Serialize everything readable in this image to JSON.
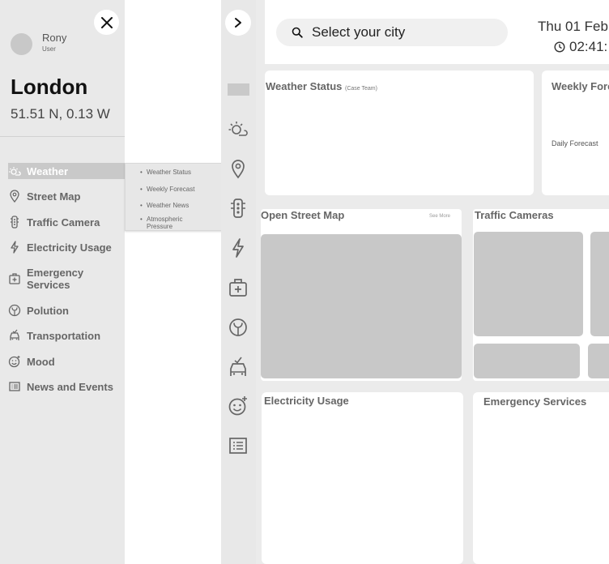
{
  "drawer": {
    "user": {
      "name": "Rony",
      "role": "User"
    },
    "city": "London",
    "coordinates": "51.51 N, 0.13 W",
    "nav": [
      {
        "label": "Weather",
        "icon": "weather-icon",
        "active": true
      },
      {
        "label": "Street Map",
        "icon": "location-pin-icon"
      },
      {
        "label": "Traffic Camera",
        "icon": "traffic-light-icon"
      },
      {
        "label": "Electricity Usage",
        "icon": "lightning-icon"
      },
      {
        "label": "Emergency Services",
        "icon": "first-aid-icon"
      },
      {
        "label": "Polution",
        "icon": "leaf-icon"
      },
      {
        "label": "Transportation",
        "icon": "bus-icon"
      },
      {
        "label": "Mood",
        "icon": "smiley-icon"
      },
      {
        "label": "News and Events",
        "icon": "news-icon"
      }
    ]
  },
  "submenu": {
    "items": [
      "Weather Status",
      "Weekly Forecast",
      "Weather News",
      "Atmospheric Pressure"
    ]
  },
  "header": {
    "search_placeholder": "Select your city",
    "date": "Thu 01 Febr",
    "time": "02:41:"
  },
  "cards": {
    "weather_status": {
      "title": "Weather Status",
      "subtitle": "(Case Team)"
    },
    "weekly_forecast": {
      "title": "Weekly Fore",
      "daily_label": "Daily Forecast"
    },
    "street_map": {
      "title": "Open Street Map",
      "see_more": "See More"
    },
    "traffic_cameras": {
      "title": "Traffic Cameras"
    },
    "electricity": {
      "title": "Electricity Usage"
    },
    "emergency": {
      "title": "Emergency Services"
    }
  },
  "colors": {
    "drawer_bg": "#e9e9e9",
    "active_bg": "#c9c9c9",
    "placeholder": "#c8c8c8",
    "main_bg": "#ebebeb"
  }
}
